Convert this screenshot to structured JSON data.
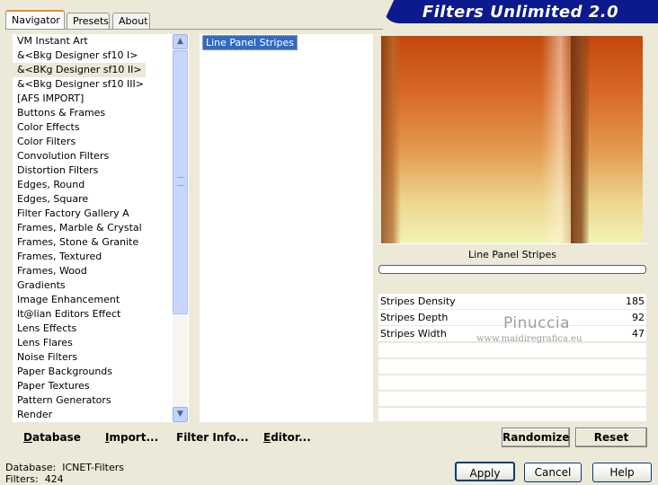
{
  "tabs": [
    {
      "label": "Navigator",
      "active": true
    },
    {
      "label": "Presets",
      "active": false
    },
    {
      "label": "About",
      "active": false
    }
  ],
  "title": "Filters Unlimited 2.0",
  "categories": [
    "VM Instant Art",
    "&<Bkg Designer sf10 I>",
    "&<BKg Designer sf10 II>",
    "&<Bkg Designer sf10 III>",
    "[AFS IMPORT]",
    "Buttons & Frames",
    "Color Effects",
    "Color Filters",
    "Convolution Filters",
    "Distortion Filters",
    "Edges, Round",
    "Edges, Square",
    "Filter Factory Gallery A",
    "Frames, Marble & Crystal",
    "Frames, Stone & Granite",
    "Frames, Textured",
    "Frames, Wood",
    "Gradients",
    "Image Enhancement",
    "It@lian Editors Effect",
    "Lens Effects",
    "Lens Flares",
    "Noise Filters",
    "Paper Backgrounds",
    "Paper Textures",
    "Pattern Generators",
    "Render"
  ],
  "selected_category_index": 2,
  "filters": [
    "Line Panel Stripes"
  ],
  "filter_name": "Line Panel Stripes",
  "params": [
    {
      "name": "Stripes Density",
      "value": "185"
    },
    {
      "name": "Stripes Depth",
      "value": "92"
    },
    {
      "name": "Stripes Width",
      "value": "47"
    }
  ],
  "watermark": {
    "line1": "Pinuccia",
    "line2": "www.maidiregrafica.eu"
  },
  "buttons": {
    "database": {
      "u": "D",
      "rest": "atabase"
    },
    "import": {
      "u": "I",
      "rest": "mport..."
    },
    "filter_info": {
      "u": "",
      "rest": "Filter Info..."
    },
    "editor": {
      "u": "E",
      "rest": "ditor..."
    },
    "randomize": "Randomize",
    "reset": "Reset",
    "apply": "Apply",
    "cancel": "Cancel",
    "help": "Help"
  },
  "status": {
    "database_label": "Database:",
    "database_value": "ICNET-Filters",
    "filters_label": "Filters:",
    "filters_value": "424"
  },
  "colors": {
    "title_banner": "#0b1a8c",
    "selection": "#316ac5",
    "window_bg": "#ece9d8"
  }
}
